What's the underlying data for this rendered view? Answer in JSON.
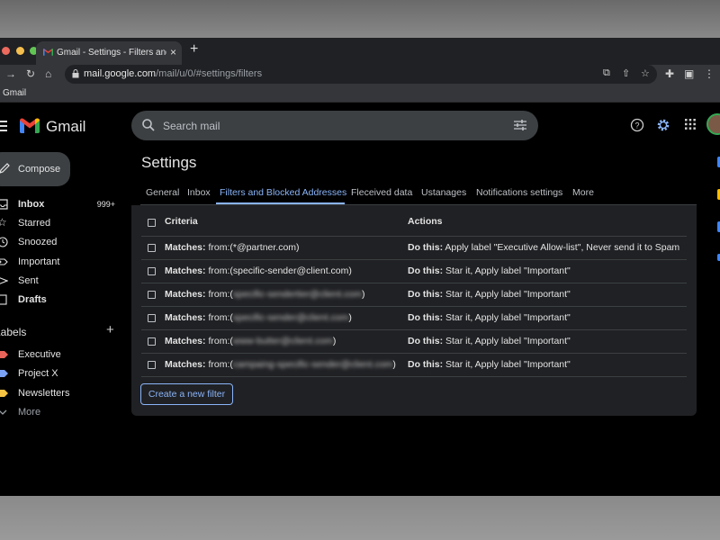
{
  "browser": {
    "tab_title": "Gmail - Settings - Filters and Bl",
    "tab_close": "×",
    "new_tab": "+",
    "url_host": "mail.google.com",
    "url_path": "/mail/u/0/#settings/filters",
    "bookmark": "Gmail"
  },
  "header": {
    "app_name": "Gmail",
    "search_placeholder": "Search mail"
  },
  "sidebar": {
    "compose_label": "Compose",
    "items": [
      {
        "label": "Inbox",
        "count": "999+"
      },
      {
        "label": "Starred"
      },
      {
        "label": "Snoozed"
      },
      {
        "label": "Important"
      },
      {
        "label": "Sent"
      },
      {
        "label": "Drafts"
      }
    ],
    "labels_title": "Labels",
    "labels_add": "+",
    "labels": [
      {
        "label": "Executive",
        "color": "#e8645a"
      },
      {
        "label": "Project X",
        "color": "#7aa2f7"
      },
      {
        "label": "Newsletters",
        "color": "#f6c343"
      },
      {
        "label": "More"
      }
    ]
  },
  "settings": {
    "title": "Settings",
    "tabs": [
      "General",
      "Inbox",
      "Filters and Blocked Addresses",
      "Fleceived data",
      "Ustanages",
      "Notifications settings",
      "More"
    ],
    "active_tab": "Filters and Blocked Addresses",
    "col_criteria": "Criteria",
    "col_actions": "Actions",
    "matches_label": "Matches:",
    "do_this_label": "Do this:",
    "rows": [
      {
        "prefix": "from:(*@partner.com)",
        "blurred": "",
        "suffix": "",
        "action": "Apply label \"Executive Allow-list\", Never send it to Spam"
      },
      {
        "prefix": "from:(specific-sender@client.com)",
        "blurred": "",
        "suffix": "",
        "action": "Star it, Apply label \"Important\""
      },
      {
        "prefix": "from:(",
        "blurred": "specific-sendertier@client.com",
        "suffix": ")",
        "action": "Star it, Apply label \"Important\""
      },
      {
        "prefix": "from:(",
        "blurred": "specific-sender@client.com",
        "suffix": ")",
        "action": "Star it, Apply label \"Important\""
      },
      {
        "prefix": "from:(",
        "blurred": "www-butter@client.com",
        "suffix": ")",
        "action": "Star it, Apply label \"Important\""
      },
      {
        "prefix": "from:(",
        "blurred": "campaing-specific-sender@client.com",
        "suffix": ")",
        "action": "Star it, Apply label \"Important\""
      }
    ],
    "create_filter_label": "Create a new filter"
  }
}
